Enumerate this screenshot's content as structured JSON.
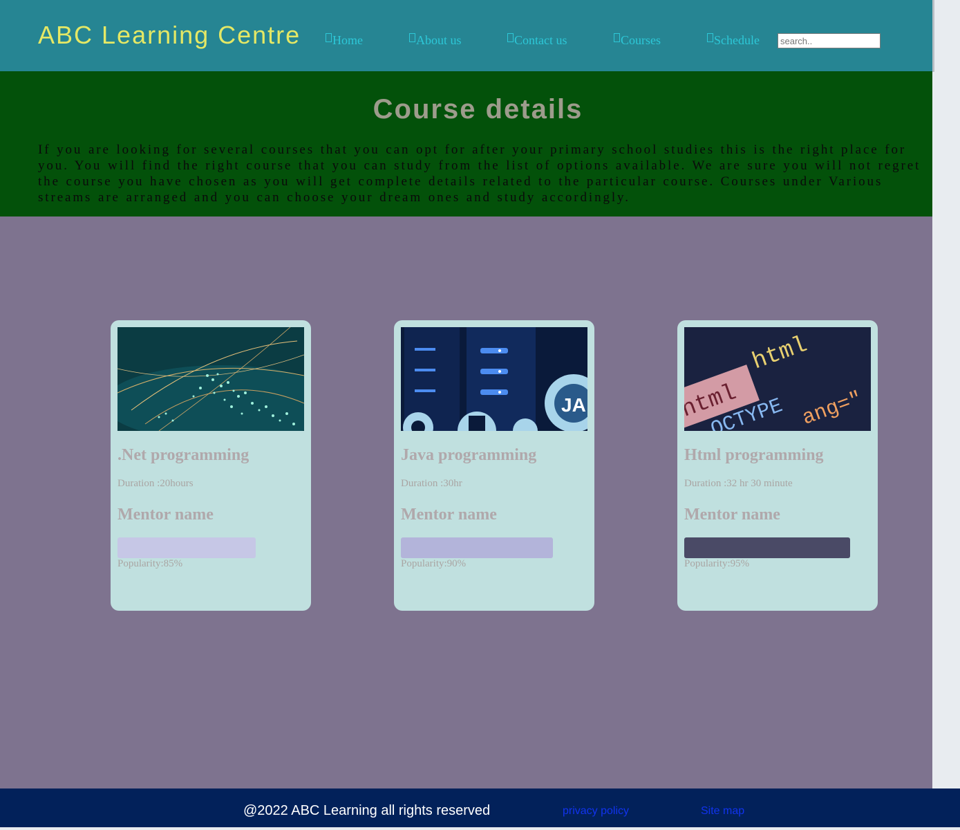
{
  "header": {
    "logo": "ABC Learning Centre",
    "nav": [
      {
        "label": "Home"
      },
      {
        "label": "About us"
      },
      {
        "label": "Contact us"
      },
      {
        "label": "Courses"
      },
      {
        "label": "Schedule"
      }
    ],
    "search_placeholder": "search.."
  },
  "hero": {
    "title": "Course details",
    "text": "If you are looking for several courses that you can opt for after your primary school studies this is the right place for you. You will find the right course that you can study from the list of options available. We are sure you will not regret the course you have chosen as you will get complete details related to the particular course. Courses under Various streams are arranged and you can choose your dream ones and study accordingly."
  },
  "courses": [
    {
      "title": ".Net programming",
      "duration": "Duration :20hours",
      "mentor": "Mentor name",
      "popularity": "Popularity:85%",
      "popularity_value": 0.85,
      "bar_color": "#c6c7e6"
    },
    {
      "title": "Java programming",
      "duration": "Duration :30hr",
      "mentor": "Mentor name",
      "popularity": "Popularity:90%",
      "popularity_value": 0.9,
      "bar_color": "#b3b4da"
    },
    {
      "title": "Html programming",
      "duration": "Duration :32 hr 30 minute",
      "mentor": "Mentor name",
      "popularity": "Popularity:95%",
      "popularity_value": 0.95,
      "bar_color": "#4a4a66"
    }
  ],
  "footer": {
    "copyright": "@2022 ABC Learning all rights reserved",
    "privacy": "privacy policy",
    "sitemap": "Site map"
  },
  "colors": {
    "header_bg": "#268593",
    "logo": "#e5e865",
    "nav_link": "#2dc8d8",
    "hero_bg": "#03510a",
    "main_bg": "#7e738f",
    "card_bg": "#c0e0df",
    "footer_bg": "#02215a"
  }
}
